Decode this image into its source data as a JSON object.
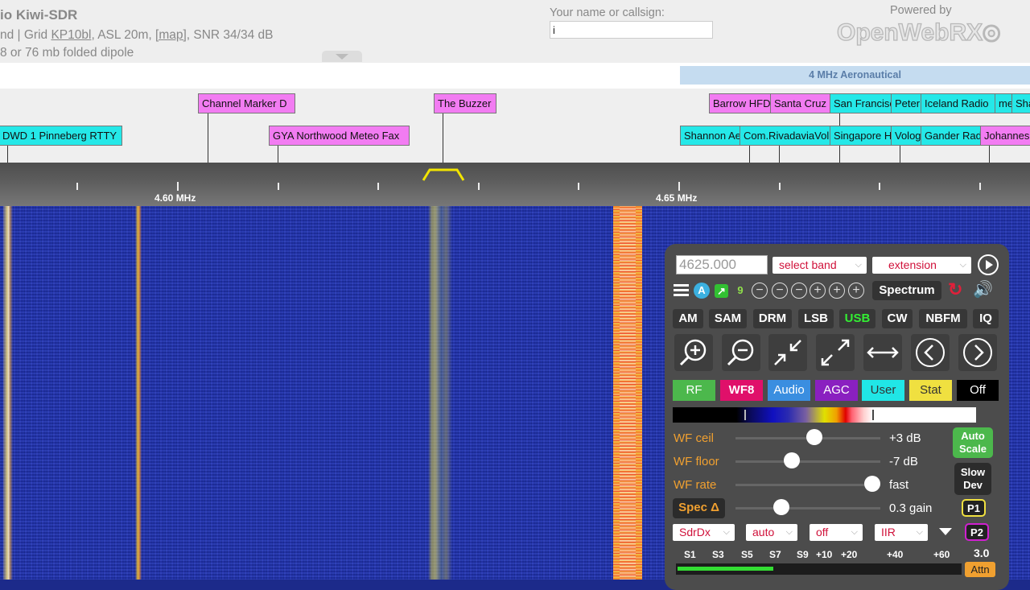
{
  "header": {
    "title": "io Kiwi-SDR",
    "line2_a": "nd | Grid ",
    "grid": "KP10bl",
    "line2_b": ", ASL 20m, ",
    "map": "[map]",
    "line2_c": ", SNR 34/34 dB",
    "line3": "8 or 76 mb folded dipole",
    "name_label": "Your name or callsign:",
    "name_value": "i",
    "powered_by": "Powered by",
    "logo": "OpenWebRX"
  },
  "band_bar": {
    "band_label": "4 MHz Aeronautical"
  },
  "labels": {
    "channel_marker_d": "Channel Marker D",
    "the_buzzer": "The Buzzer",
    "dwd": "DWD 1 Pinneberg RTTY",
    "gya": "GYA Northwood Meteo Fax",
    "barrow": "Barrow HFDL",
    "santa_cruz": "Santa Cruz",
    "san_francisco": "San Francisco",
    "peter": "Peter",
    "iceland": "Iceland Radio",
    "me": "me",
    "sha": "Sha",
    "shannon": "Shannon Aero",
    "com_rivadavia": "Com.RivadaviaVolmet",
    "singapore": "Singapore HFDL",
    "vologda": "Vologda",
    "gander": "Gander Radio",
    "johannesburg": "Johannesburg"
  },
  "scale": {
    "label_1": "4.60 MHz",
    "label_2": "4.65 MHz"
  },
  "panel": {
    "frequency": "4625.000",
    "select_band": "select band",
    "extension": "extension",
    "chip_a": "A",
    "chip_9": "9",
    "spectrum": "Spectrum",
    "modes": [
      "AM",
      "SAM",
      "DRM",
      "LSB",
      "USB",
      "CW",
      "NBFM",
      "IQ"
    ],
    "active_mode": "USB",
    "tabs": [
      "RF",
      "WF8",
      "Audio",
      "AGC",
      "User",
      "Stat",
      "Off"
    ],
    "wf_ceil_label": "WF ceil",
    "wf_ceil_value": "+3 dB",
    "wf_floor_label": "WF floor",
    "wf_floor_value": "-7 dB",
    "wf_rate_label": "WF rate",
    "wf_rate_value": "fast",
    "spec_label": "Spec Δ",
    "spec_value": "0.3 gain",
    "auto_scale": [
      "Auto",
      "Scale"
    ],
    "slow_dev": [
      "Slow",
      "Dev"
    ],
    "p1": "P1",
    "p2": "P2",
    "sel_sdrdx": "SdrDx",
    "sel_auto": "auto",
    "sel_off": "off",
    "sel_iir": "IIR",
    "smeter_labels": [
      "S1",
      "S3",
      "S5",
      "S7",
      "S9",
      "+10",
      "+20",
      "+40",
      "+60"
    ],
    "smeter_value": "3.0",
    "attn": "Attn",
    "smeter_level": 0.34
  },
  "colors": {
    "mode_active": "#33ee33",
    "tab_rf": "#4cb84c",
    "tab_wf8": "#e0106a",
    "tab_audio": "#3a8ee0",
    "tab_agc": "#8a20c0",
    "tab_user": "#20e6e6",
    "tab_stat": "#f0e040",
    "tab_off": "#000000",
    "label_pink": "#f27cf2",
    "label_cyan": "#25e8e8"
  }
}
